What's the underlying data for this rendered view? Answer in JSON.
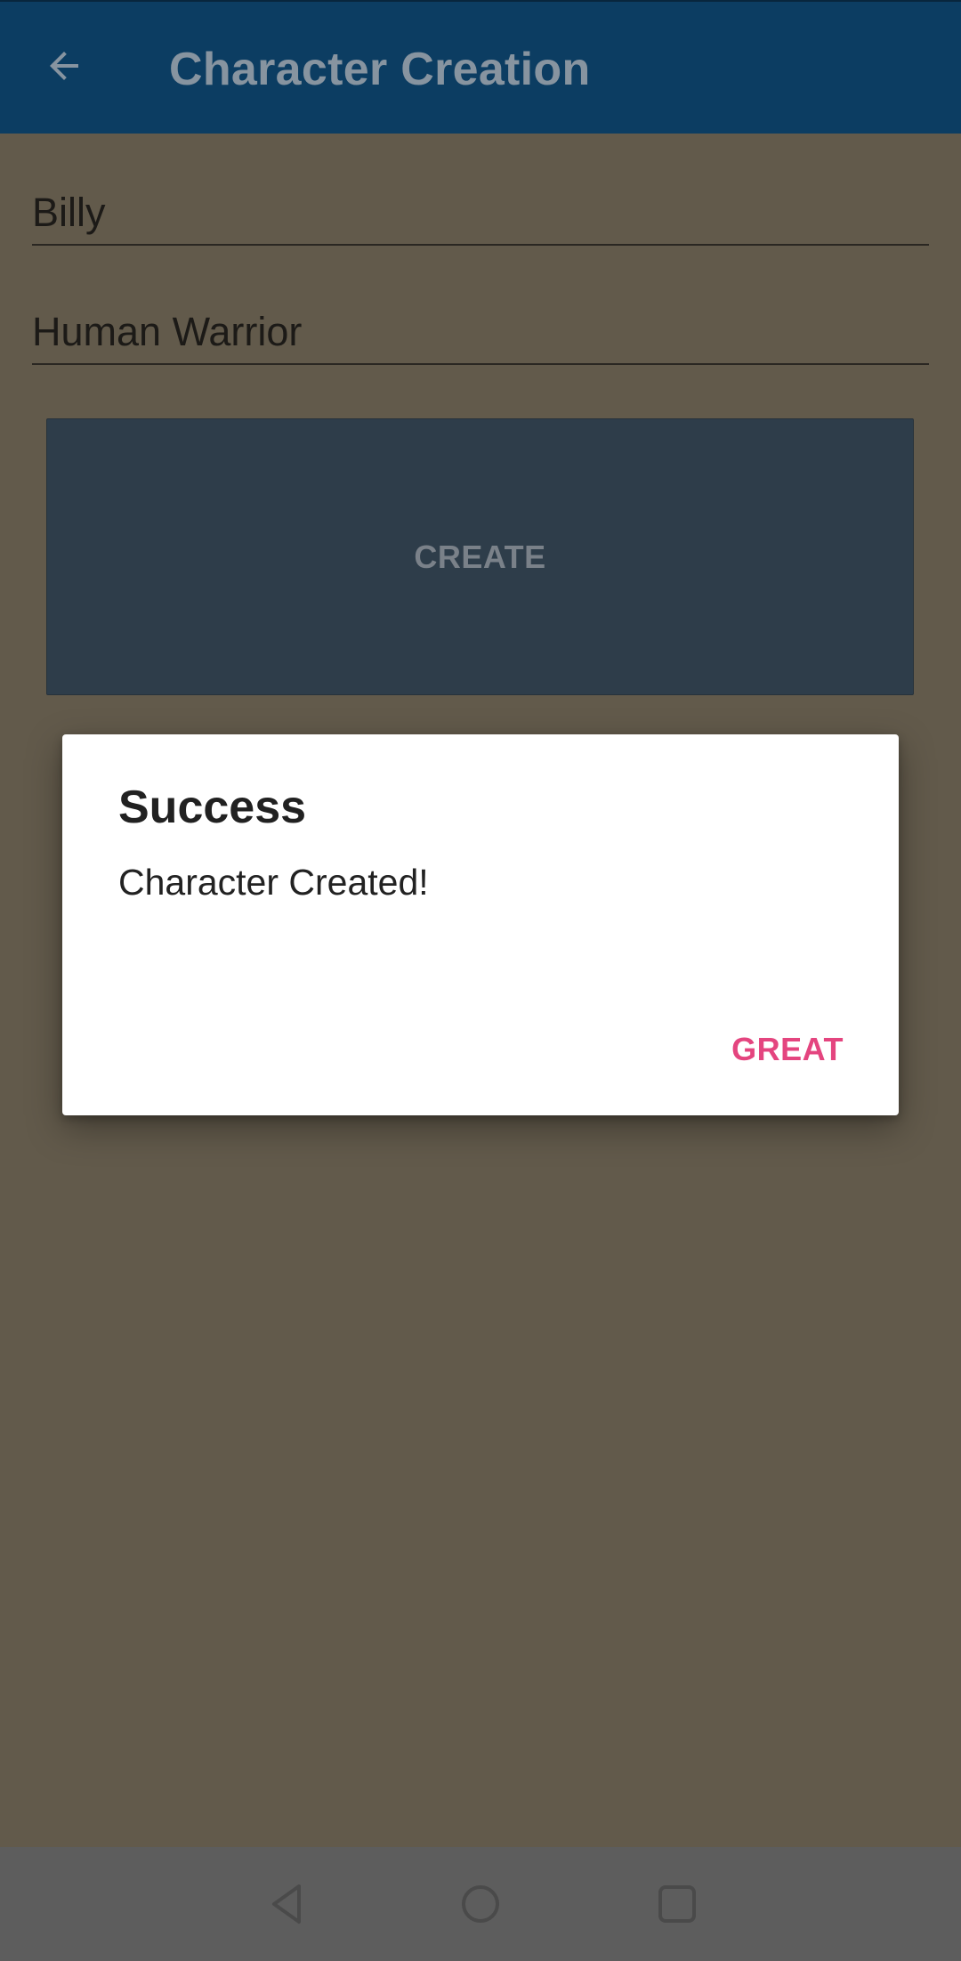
{
  "app_bar": {
    "title": "Character Creation",
    "back_icon": "arrow-back-icon",
    "background_color": "#0c3d62"
  },
  "form": {
    "name_value": "Billy",
    "class_value": "Human Warrior",
    "create_label": "CREATE"
  },
  "dialog": {
    "title": "Success",
    "message": "Character Created!",
    "action_label": "GREAT",
    "action_color": "#e4457f"
  },
  "system_nav": {
    "back_icon": "nav-back-icon",
    "home_icon": "nav-home-icon",
    "recents_icon": "nav-recents-icon"
  }
}
